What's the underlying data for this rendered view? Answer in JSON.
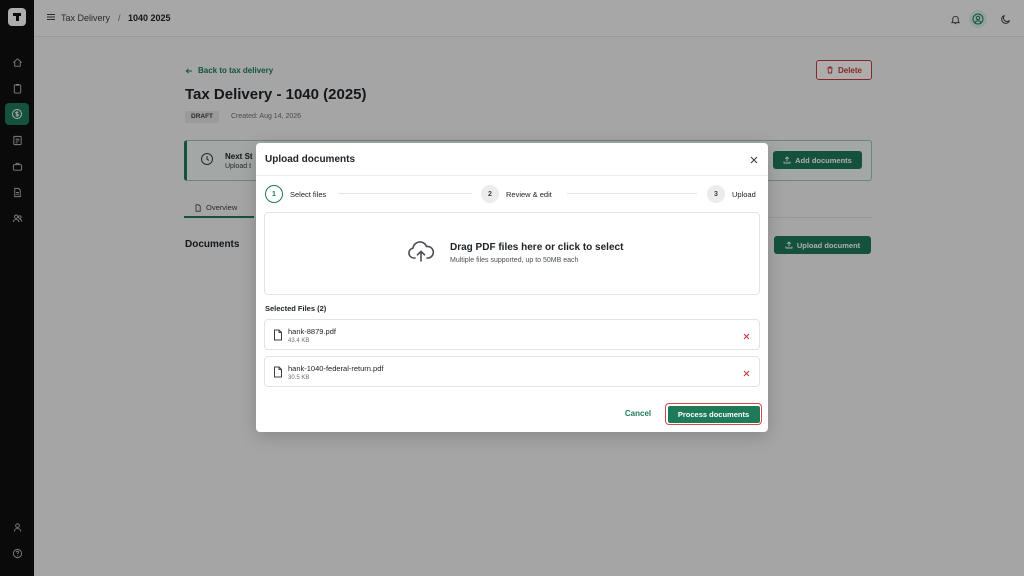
{
  "breadcrumb": {
    "section": "Tax Delivery",
    "separator": "/",
    "current": "1040 2025"
  },
  "page": {
    "back_link": "Back to tax delivery",
    "title": "Tax Delivery - 1040 (2025)",
    "status_badge": "DRAFT",
    "created": "Created: Aug 14, 2026",
    "delete_label": "Delete",
    "next_step_title": "Next St",
    "next_step_sub": "Upload t",
    "add_documents_label": "Add documents",
    "tab_overview": "Overview",
    "documents_heading": "Documents",
    "upload_document_label": "Upload document"
  },
  "modal": {
    "title": "Upload documents",
    "steps": [
      {
        "number": "1",
        "label": "Select files",
        "state": "active"
      },
      {
        "number": "2",
        "label": "Review & edit",
        "state": "inactive"
      },
      {
        "number": "3",
        "label": "Upload",
        "state": "inactive"
      }
    ],
    "dropzone": {
      "title": "Drag PDF files here or click to select",
      "subtitle": "Multiple files supported, up to 50MB each"
    },
    "selected_files_label": "Selected Files (2)",
    "files": [
      {
        "name": "hank-8879.pdf",
        "size": "43.4 KB"
      },
      {
        "name": "hank-1040-federal-return.pdf",
        "size": "30.5 KB"
      }
    ],
    "cancel_label": "Cancel",
    "process_label": "Process documents"
  },
  "colors": {
    "accent": "#1f7a5a",
    "danger": "#c93a3a",
    "sidebar": "#0f0f0f"
  }
}
